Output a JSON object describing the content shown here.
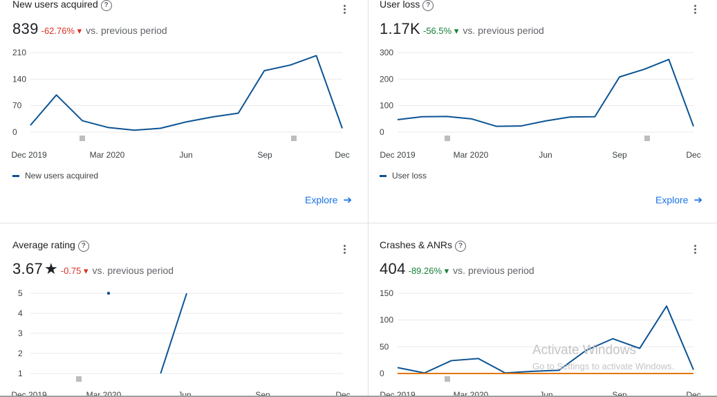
{
  "cards": [
    {
      "title": "New users acquired",
      "value": "839",
      "change": "-62.76%",
      "change_dir": "down",
      "comparison": "vs. previous period",
      "legend": "New users acquired",
      "explore": "Explore",
      "icon_help": "help-circle-icon",
      "icon_more": "more-vert-icon"
    },
    {
      "title": "User loss",
      "value": "1.17K",
      "change": "-56.5%",
      "change_dir": "up",
      "comparison": "vs. previous period",
      "legend": "User loss",
      "explore": "Explore",
      "icon_help": "help-circle-icon",
      "icon_more": "more-vert-icon"
    },
    {
      "title": "Average rating",
      "value": "3.67",
      "change": "-0.75",
      "change_dir": "down",
      "comparison": "vs. previous period",
      "icon_help": "help-circle-icon",
      "icon_more": "more-vert-icon",
      "icon_star": "star-icon"
    },
    {
      "title": "Crashes & ANRs",
      "value": "404",
      "change": "-89.26%",
      "change_dir": "up",
      "comparison": "vs. previous period",
      "icon_help": "help-circle-icon",
      "icon_more": "more-vert-icon"
    }
  ],
  "colors": {
    "line": "#0b5394",
    "orange": "#e37400",
    "grid": "#e8eaed",
    "down": "#d93025",
    "up": "#188038",
    "link": "#1a73e8"
  },
  "watermark": {
    "line1": "Activate Windows",
    "line2": "Go to Settings to activate Windows."
  },
  "chart_data": [
    {
      "type": "line",
      "x": [
        "Dec 2019",
        "Jan 2020",
        "Feb 2020",
        "Mar 2020",
        "Apr 2020",
        "May 2020",
        "Jun 2020",
        "Jul 2020",
        "Aug 2020",
        "Sep 2020",
        "Oct 2020",
        "Nov 2020",
        "Dec 2020"
      ],
      "x_ticks": [
        "Dec 2019",
        "Mar 2020",
        "Jun",
        "Sep",
        "Dec"
      ],
      "y_ticks": [
        "0",
        "70",
        "140",
        "210"
      ],
      "ylim": [
        0,
        210
      ],
      "series": [
        {
          "name": "New users acquired",
          "values": [
            18,
            98,
            30,
            12,
            5,
            10,
            27,
            40,
            50,
            162,
            177,
            202,
            10
          ]
        }
      ]
    },
    {
      "type": "line",
      "x": [
        "Dec 2019",
        "Jan 2020",
        "Feb 2020",
        "Mar 2020",
        "Apr 2020",
        "May 2020",
        "Jun 2020",
        "Jul 2020",
        "Aug 2020",
        "Sep 2020",
        "Oct 2020",
        "Nov 2020",
        "Dec 2020"
      ],
      "x_ticks": [
        "Dec 2019",
        "Mar 2020",
        "Jun",
        "Sep",
        "Dec"
      ],
      "y_ticks": [
        "0",
        "100",
        "200",
        "300"
      ],
      "ylim": [
        0,
        300
      ],
      "series": [
        {
          "name": "User loss",
          "values": [
            47,
            58,
            59,
            50,
            22,
            23,
            42,
            57,
            58,
            208,
            237,
            274,
            22
          ]
        }
      ]
    },
    {
      "type": "line",
      "x_ticks": [
        "Dec 2019",
        "Mar 2020",
        "Jun",
        "Sep",
        "Dec"
      ],
      "y_ticks": [
        "1",
        "2",
        "3",
        "4",
        "5"
      ],
      "ylim": [
        1,
        5
      ],
      "points": [
        {
          "x": "Mar 2020",
          "y": 5
        }
      ],
      "series": [
        {
          "values": [
            {
              "x": "May 2020",
              "y": 1
            },
            {
              "x": "Jun 2020",
              "y": 5
            }
          ]
        }
      ]
    },
    {
      "type": "line",
      "x_ticks": [
        "Dec 2019",
        "Mar 2020",
        "Jun",
        "Sep",
        "Dec"
      ],
      "y_ticks": [
        "0",
        "50",
        "100",
        "150"
      ],
      "ylim": [
        0,
        150
      ],
      "series": [
        {
          "values": [
            11,
            1,
            24,
            28,
            1,
            4,
            6,
            43,
            65,
            47,
            126,
            7
          ]
        },
        {
          "values": [
            0,
            0,
            0,
            0,
            0,
            0,
            0,
            0,
            0,
            0,
            0,
            0
          ]
        }
      ]
    }
  ]
}
